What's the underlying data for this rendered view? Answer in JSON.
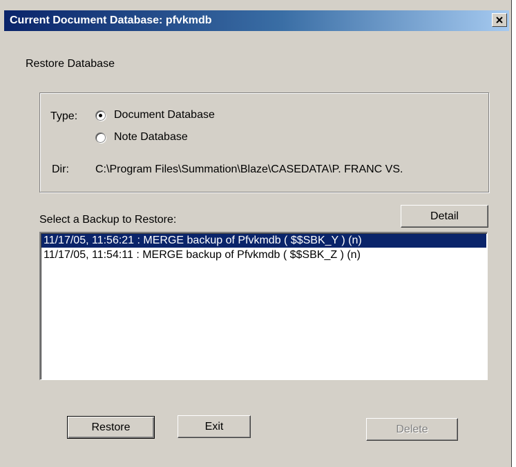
{
  "window": {
    "title": "Current Document Database:  pfvkmdb",
    "close_icon": "close-icon"
  },
  "restore": {
    "section_label": "Restore Database",
    "type_label": "Type:",
    "options": [
      {
        "label": "Document Database",
        "selected": true
      },
      {
        "label": "Note Database",
        "selected": false
      }
    ],
    "dir_label": "Dir:",
    "dir_value": "C:\\Program Files\\Summation\\Blaze\\CASEDATA\\P. FRANC VS."
  },
  "backups": {
    "label": "Select a Backup to Restore:",
    "detail_label": "Detail",
    "items": [
      {
        "text": "11/17/05, 11:56:21 : MERGE   backup of Pfvkmdb ( $$SBK_Y ) (n)",
        "selected": true
      },
      {
        "text": "11/17/05, 11:54:11 : MERGE   backup of Pfvkmdb ( $$SBK_Z ) (n)",
        "selected": false
      }
    ]
  },
  "buttons": {
    "restore_label": "Restore",
    "exit_label": "Exit",
    "delete_label": "Delete",
    "delete_enabled": false
  },
  "colors": {
    "titlebar_start": "#0a246a",
    "titlebar_end": "#a6caf0",
    "selection": "#0a246a",
    "dialog_bg": "#d4d0c8"
  }
}
